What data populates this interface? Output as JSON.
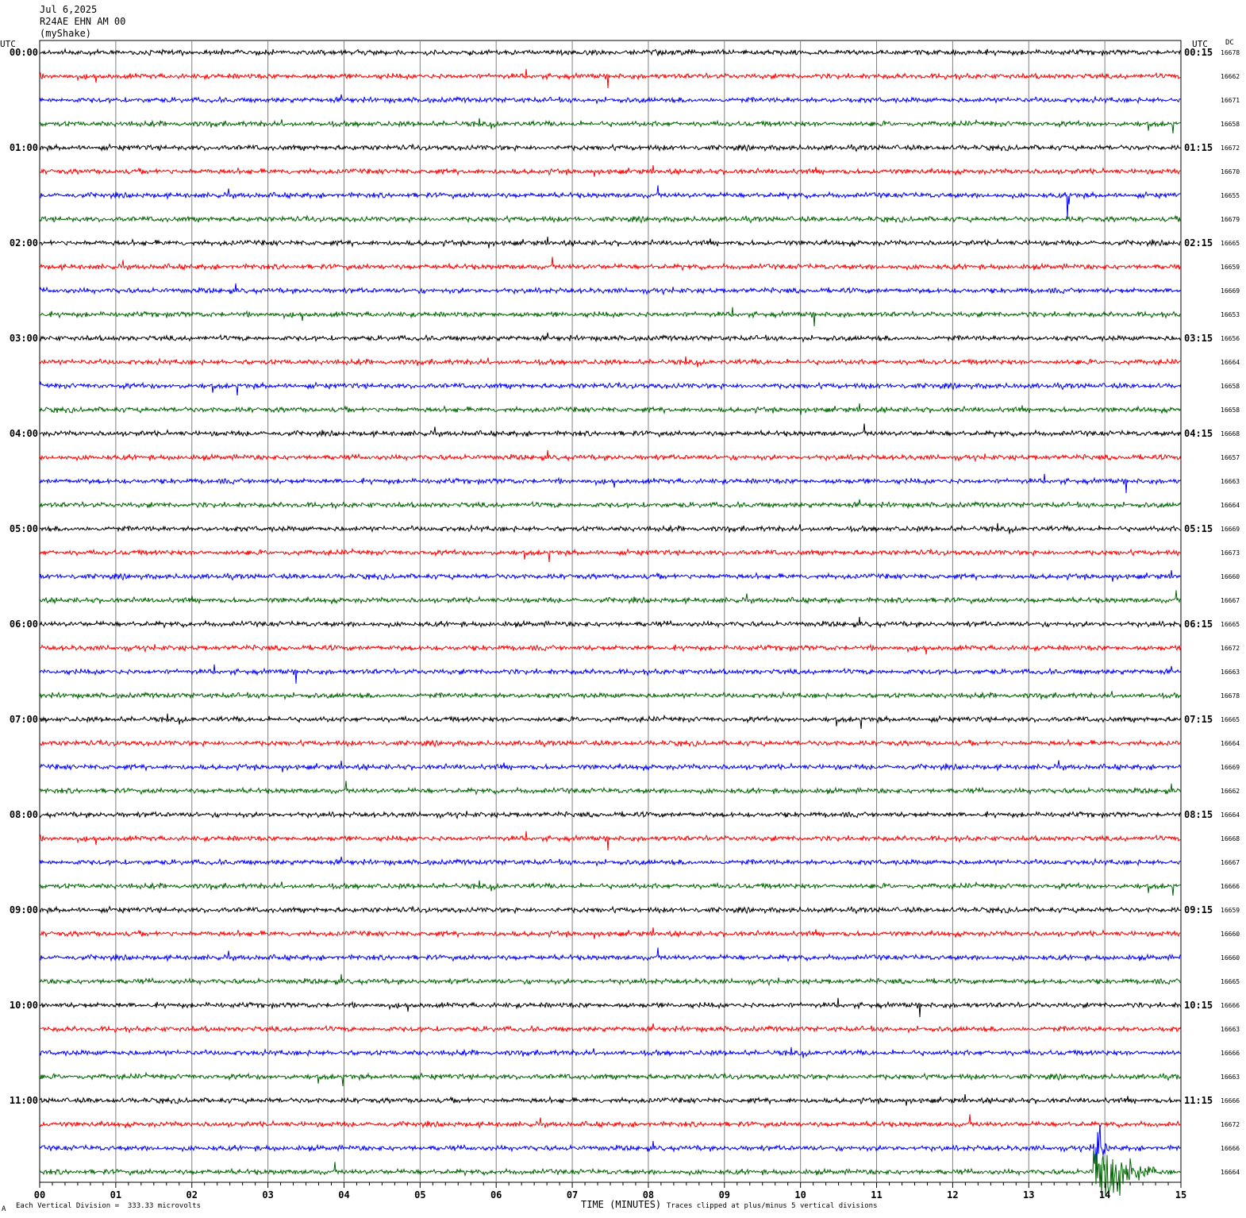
{
  "header": {
    "date": "Jul 6,2025",
    "station": "R24AE EHN AM 00",
    "network": "(myShake)"
  },
  "corners": {
    "left_tz": "UTC",
    "right_tz": "UTC",
    "dc_header": "DC"
  },
  "footer": {
    "scale_note": "Each Vertical Division =  333.33 microvolts",
    "clip_note": "Traces clipped at plus/minus 5 vertical divisions",
    "corner_mark": "A"
  },
  "colors": {
    "cycle": [
      "#000000",
      "#ff0000",
      "#0000ff",
      "#006400"
    ],
    "grid": "#808080"
  },
  "chart_data": {
    "type": "line",
    "title": "R24AE EHN AM 00",
    "xlabel": "TIME (MINUTES)",
    "x_ticks": [
      "00",
      "01",
      "02",
      "03",
      "04",
      "05",
      "06",
      "07",
      "08",
      "09",
      "10",
      "11",
      "12",
      "13",
      "14",
      "15"
    ],
    "xlim": [
      0,
      15
    ],
    "minutes_per_line": 15,
    "color_cycle": [
      "black",
      "red",
      "blue",
      "darkgreen"
    ],
    "left_time_labels": [
      "00:00",
      "01:00",
      "02:00",
      "03:00",
      "04:00",
      "05:00",
      "06:00",
      "07:00",
      "08:00",
      "09:00",
      "10:00",
      "11:00"
    ],
    "right_time_labels": [
      "00:15",
      "01:15",
      "02:15",
      "03:15",
      "04:15",
      "05:15",
      "06:15",
      "07:15",
      "08:15",
      "09:15",
      "10:15",
      "11:15"
    ],
    "dc_offsets": [
      16678,
      16662,
      16671,
      16658,
      16672,
      16670,
      16655,
      16679,
      16665,
      16659,
      16669,
      16653,
      16656,
      16664,
      16658,
      16658,
      16668,
      16657,
      16663,
      16664,
      16669,
      16673,
      16660,
      16667,
      16665,
      16672,
      16663,
      16678,
      16665,
      16664,
      16669,
      16662,
      16664,
      16668,
      16667,
      16666,
      16659,
      16660,
      16660,
      16665,
      16666,
      16663,
      16666,
      16663,
      16666,
      16672,
      16666,
      16664
    ],
    "events": [
      {
        "line": 6,
        "minute": 13.5,
        "amplitude_div": 5,
        "note": "clipped spike"
      },
      {
        "line": 47,
        "minute": 13.85,
        "amplitude_div": 5,
        "duration_min": 0.8,
        "note": "clipped earthquake signal"
      },
      {
        "line": 46,
        "minute": 13.85,
        "amplitude_div": 5,
        "duration_min": 0.2
      }
    ]
  }
}
